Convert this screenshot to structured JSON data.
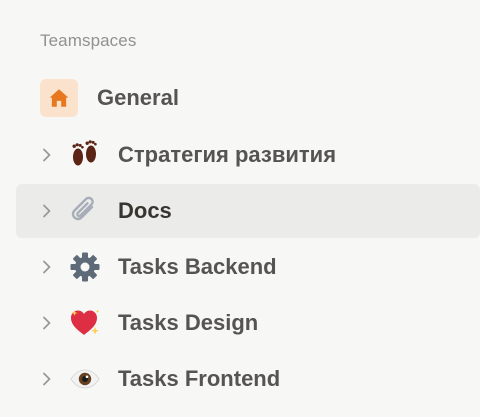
{
  "sidebar": {
    "section_label": "Teamspaces",
    "items": [
      {
        "label": "General",
        "icon": "home-icon",
        "active": false
      },
      {
        "label": "Стратегия развития",
        "icon": "footprints-icon",
        "active": false
      },
      {
        "label": "Docs",
        "icon": "paperclip-icon",
        "active": true
      },
      {
        "label": "Tasks Backend",
        "icon": "gear-icon",
        "active": false
      },
      {
        "label": "Tasks Design",
        "icon": "sparkling-heart-icon",
        "active": false
      },
      {
        "label": "Tasks Frontend",
        "icon": "eye-icon",
        "active": false
      }
    ]
  },
  "colors": {
    "background": "#f7f7f5",
    "active_row": "#ebebea",
    "home_accent": "#e8781f",
    "home_bg": "#fbe2cc",
    "muted_text": "#91918e"
  }
}
